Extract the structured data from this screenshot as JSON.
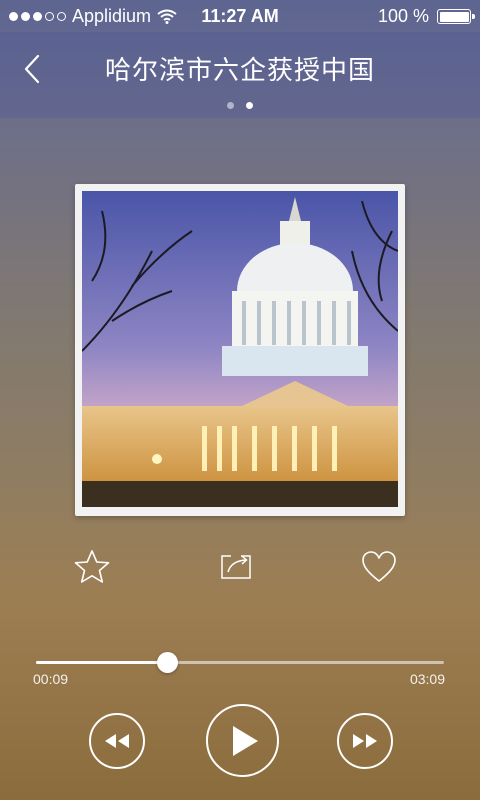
{
  "status_bar": {
    "carrier": "Applidium",
    "time": "11:27 AM",
    "battery_text": "100 %",
    "signal_dots_full": 3,
    "signal_dots_empty": 2,
    "battery_level_pct": 100
  },
  "nav": {
    "title": "哈尔滨市六企获授中国",
    "page_count": 2,
    "active_page": 2
  },
  "player": {
    "elapsed": "00:09",
    "duration": "03:09",
    "progress_pct": 32,
    "actions": [
      "star-icon",
      "share-icon",
      "heart-icon"
    ],
    "controls": [
      "rewind-icon",
      "play-icon",
      "fast-forward-icon"
    ]
  },
  "colors": {
    "accent": "#ffffff",
    "bg_top": "#5d6591",
    "bg_bottom": "#8b6c3c"
  }
}
